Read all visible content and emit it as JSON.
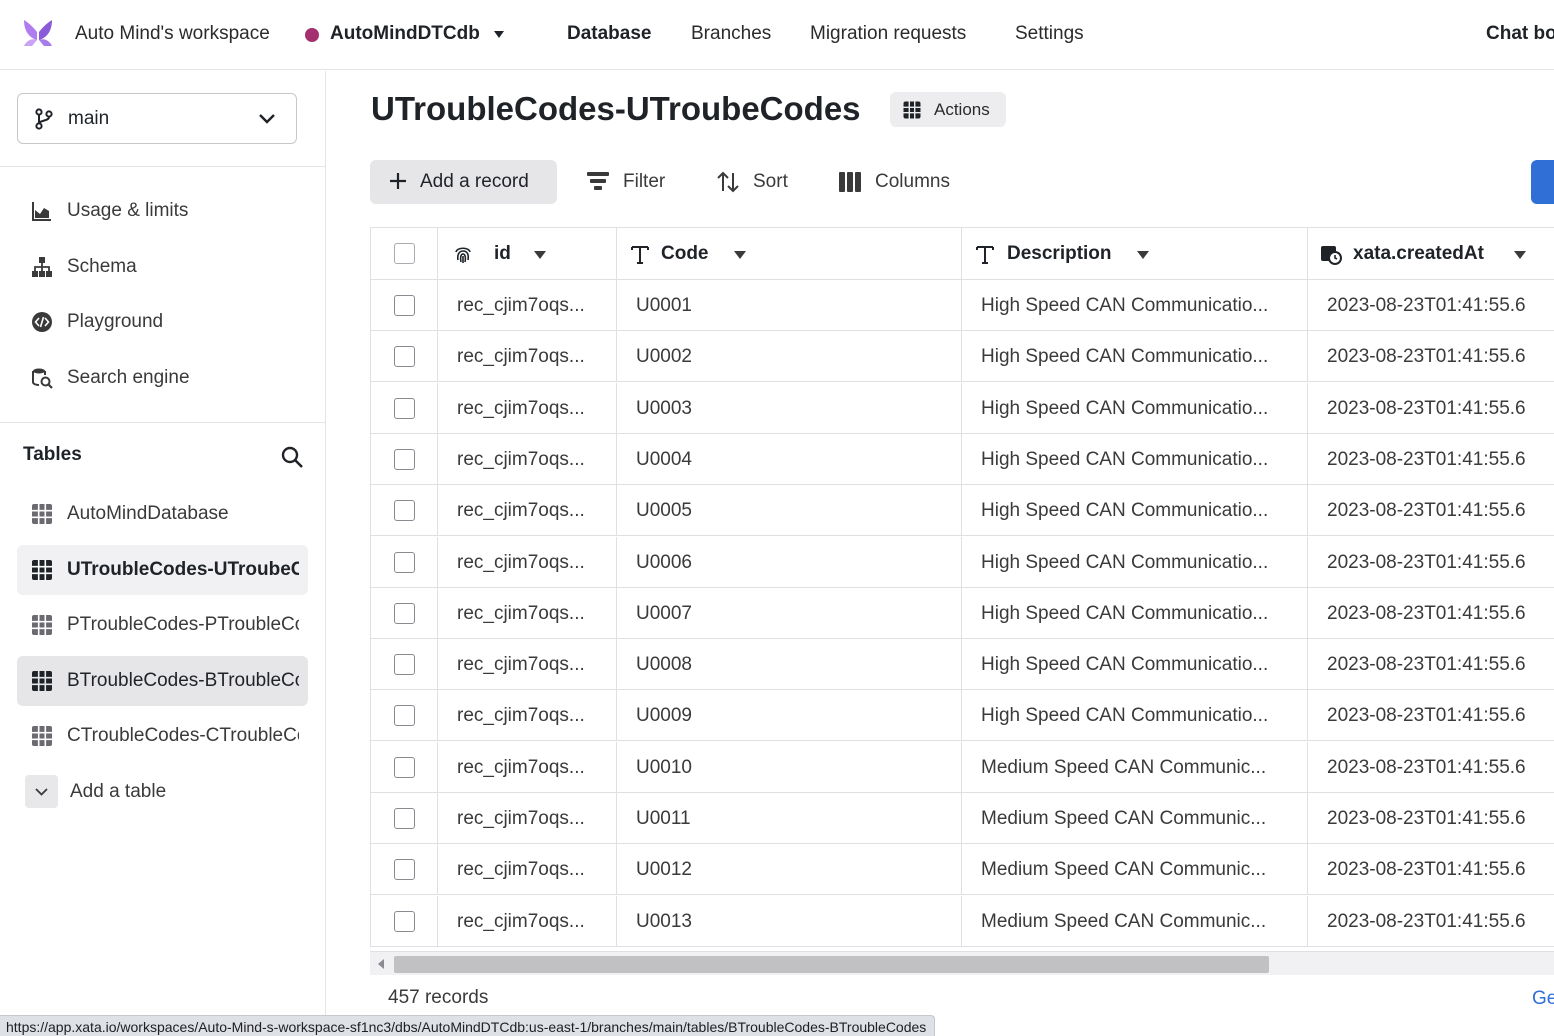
{
  "topbar": {
    "workspace": "Auto Mind's workspace",
    "database": "AutoMindDTCdb",
    "nav": [
      "Database",
      "Branches",
      "Migration requests",
      "Settings"
    ],
    "chat": "Chat bo",
    "accent": "#a4306f"
  },
  "sidebar": {
    "branch": "main",
    "menu": [
      {
        "label": "Usage & limits",
        "icon": "chart-icon"
      },
      {
        "label": "Schema",
        "icon": "schema-icon"
      },
      {
        "label": "Playground",
        "icon": "code-icon"
      },
      {
        "label": "Search engine",
        "icon": "search-engine-icon"
      }
    ],
    "tables_heading": "Tables",
    "tables": [
      "AutoMindDatabase",
      "UTroubleCodes-UTroubeCodes",
      "PTroubleCodes-PTroubleCodes",
      "BTroubleCodes-BTroubleCodes",
      "CTroubleCodes-CTroubleCodes"
    ],
    "add_table": "Add a table"
  },
  "main": {
    "title": "UTroubleCodes-UTroubeCodes",
    "actions": "Actions",
    "toolbar": {
      "add_record": "Add a record",
      "filter": "Filter",
      "sort": "Sort",
      "columns": "Columns"
    },
    "columns": [
      "id",
      "Code",
      "Description",
      "xata.createdAt"
    ],
    "rows": [
      {
        "id": "rec_cjim7oqs...",
        "code": "U0001",
        "desc": "High Speed CAN Communicatio...",
        "created": "2023-08-23T01:41:55.6"
      },
      {
        "id": "rec_cjim7oqs...",
        "code": "U0002",
        "desc": "High Speed CAN Communicatio...",
        "created": "2023-08-23T01:41:55.6"
      },
      {
        "id": "rec_cjim7oqs...",
        "code": "U0003",
        "desc": "High Speed CAN Communicatio...",
        "created": "2023-08-23T01:41:55.6"
      },
      {
        "id": "rec_cjim7oqs...",
        "code": "U0004",
        "desc": "High Speed CAN Communicatio...",
        "created": "2023-08-23T01:41:55.6"
      },
      {
        "id": "rec_cjim7oqs...",
        "code": "U0005",
        "desc": "High Speed CAN Communicatio...",
        "created": "2023-08-23T01:41:55.6"
      },
      {
        "id": "rec_cjim7oqs...",
        "code": "U0006",
        "desc": "High Speed CAN Communicatio...",
        "created": "2023-08-23T01:41:55.6"
      },
      {
        "id": "rec_cjim7oqs...",
        "code": "U0007",
        "desc": "High Speed CAN Communicatio...",
        "created": "2023-08-23T01:41:55.6"
      },
      {
        "id": "rec_cjim7oqs...",
        "code": "U0008",
        "desc": "High Speed CAN Communicatio...",
        "created": "2023-08-23T01:41:55.6"
      },
      {
        "id": "rec_cjim7oqs...",
        "code": "U0009",
        "desc": "High Speed CAN Communicatio...",
        "created": "2023-08-23T01:41:55.6"
      },
      {
        "id": "rec_cjim7oqs...",
        "code": "U0010",
        "desc": "Medium Speed CAN Communic...",
        "created": "2023-08-23T01:41:55.6"
      },
      {
        "id": "rec_cjim7oqs...",
        "code": "U0011",
        "desc": "Medium Speed CAN Communic...",
        "created": "2023-08-23T01:41:55.6"
      },
      {
        "id": "rec_cjim7oqs...",
        "code": "U0012",
        "desc": "Medium Speed CAN Communic...",
        "created": "2023-08-23T01:41:55.6"
      },
      {
        "id": "rec_cjim7oqs...",
        "code": "U0013",
        "desc": "Medium Speed CAN Communic...",
        "created": "2023-08-23T01:41:55.6"
      }
    ],
    "record_count": "457 records",
    "footer_link": "Ge"
  },
  "status_url": "https://app.xata.io/workspaces/Auto-Mind-s-workspace-sf1nc3/dbs/AutoMindDTCdb:us-east-1/branches/main/tables/BTroubleCodes-BTroubleCodes"
}
